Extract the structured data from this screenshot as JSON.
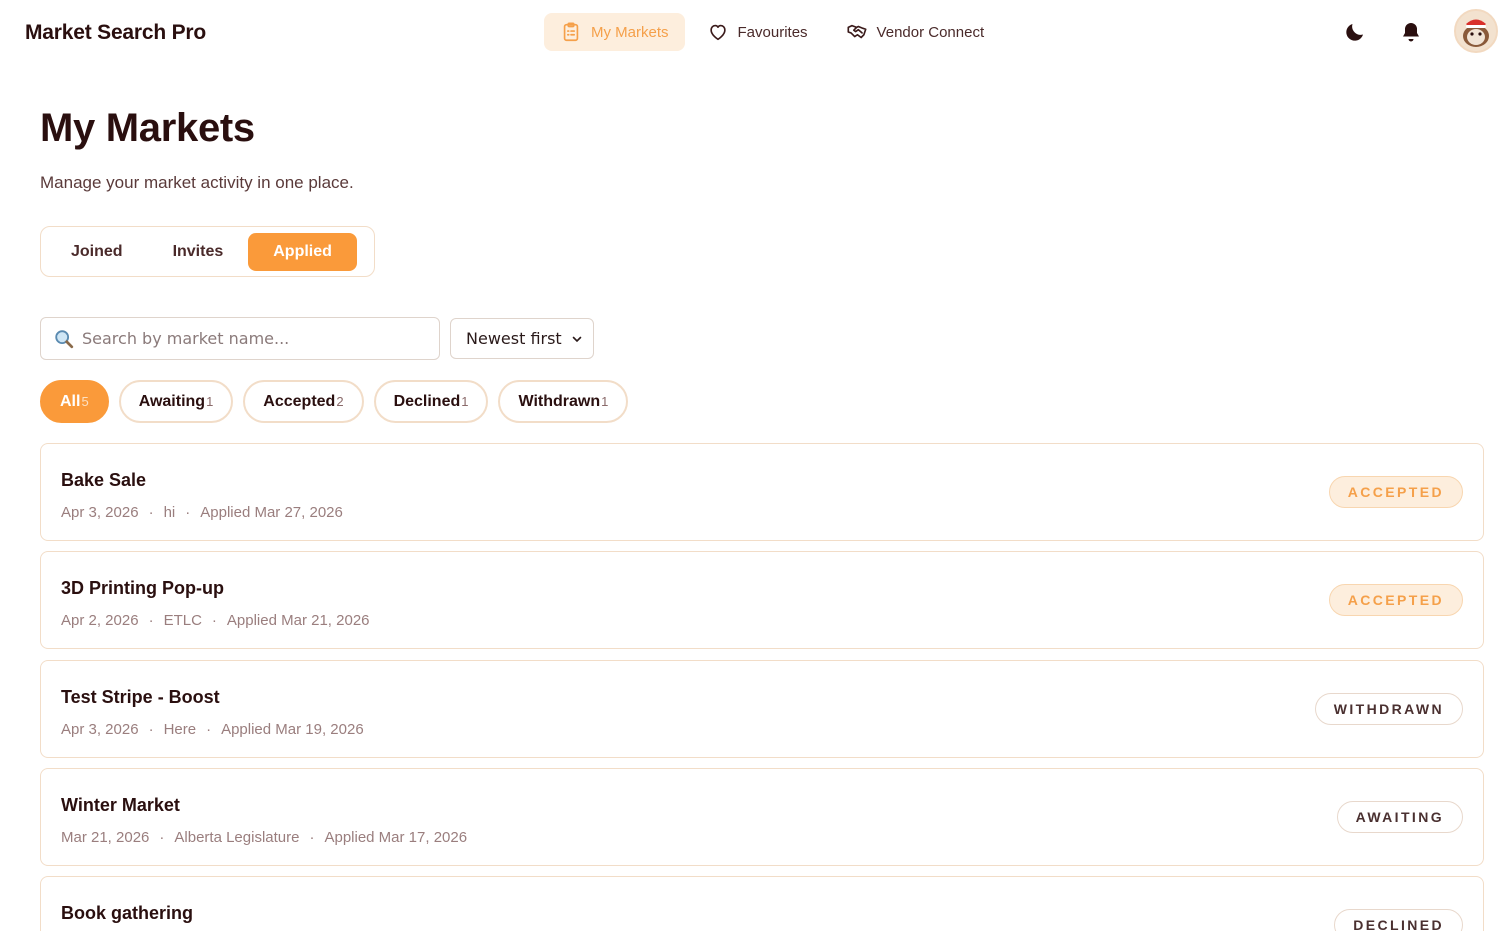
{
  "brand": "Market Search Pro",
  "nav": [
    {
      "label": "My Markets",
      "icon": "clipboard-icon",
      "active": true
    },
    {
      "label": "Favourites",
      "icon": "heart-icon",
      "active": false
    },
    {
      "label": "Vendor Connect",
      "icon": "handshake-icon",
      "active": false
    }
  ],
  "header_icons": [
    "moon-icon",
    "bell-icon"
  ],
  "page": {
    "title": "My Markets",
    "subtitle": "Manage your market activity in one place."
  },
  "tabs": [
    "Joined",
    "Invites",
    "Applied"
  ],
  "active_tab": "Applied",
  "search": {
    "placeholder": "Search by market name...",
    "value": ""
  },
  "sort": {
    "selected": "Newest first"
  },
  "filters": [
    {
      "label": "All",
      "count": "5"
    },
    {
      "label": "Awaiting",
      "count": "1"
    },
    {
      "label": "Accepted",
      "count": "2"
    },
    {
      "label": "Declined",
      "count": "1"
    },
    {
      "label": "Withdrawn",
      "count": "1"
    }
  ],
  "active_filter": "All",
  "applications": [
    {
      "name": "Bake Sale",
      "date": "Apr 3, 2026",
      "location": "hi",
      "applied": "Applied Mar 27, 2026",
      "status": "ACCEPTED"
    },
    {
      "name": "3D Printing Pop-up",
      "date": "Apr 2, 2026",
      "location": "ETLC",
      "applied": "Applied Mar 21, 2026",
      "status": "ACCEPTED"
    },
    {
      "name": "Test Stripe - Boost",
      "date": "Apr 3, 2026",
      "location": "Here",
      "applied": "Applied Mar 19, 2026",
      "status": "WITHDRAWN"
    },
    {
      "name": "Winter Market",
      "date": "Mar 21, 2026",
      "location": "Alberta Legislature",
      "applied": "Applied Mar 17, 2026",
      "status": "AWAITING"
    },
    {
      "name": "Book gathering",
      "date": "",
      "location": "",
      "applied": "",
      "status": "DECLINED"
    }
  ],
  "colors": {
    "accent": "#fa9a3a",
    "accent_soft": "#fdeedd",
    "text": "#2a0f0f",
    "border": "#f2ddc8"
  }
}
